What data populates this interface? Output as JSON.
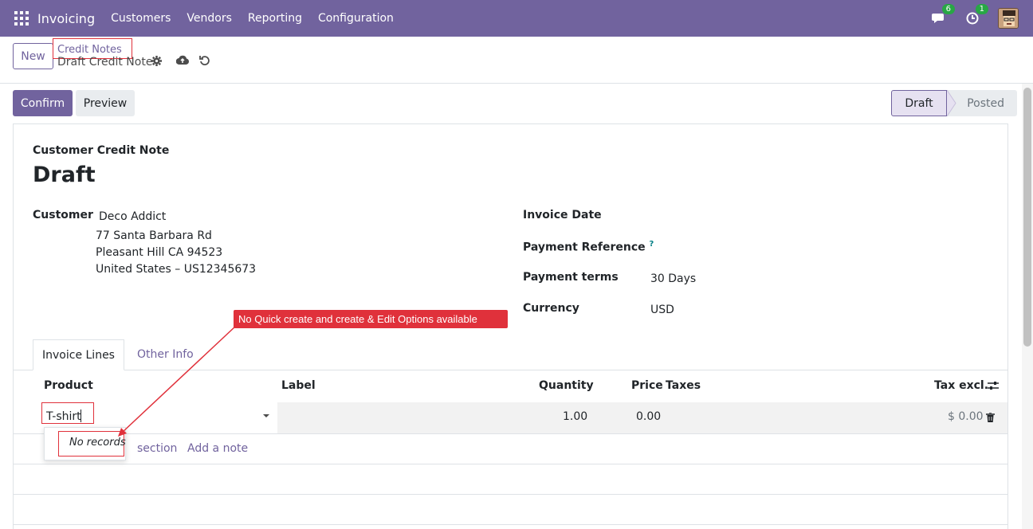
{
  "topbar": {
    "app_name": "Invoicing",
    "menu": [
      "Customers",
      "Vendors",
      "Reporting",
      "Configuration"
    ],
    "messages_badge": "6",
    "activities_badge": "1"
  },
  "control": {
    "new_label": "New",
    "breadcrumb": "Credit Notes",
    "record_name": "Draft Credit Note"
  },
  "actions": {
    "confirm_label": "Confirm",
    "preview_label": "Preview",
    "status": [
      "Draft",
      "Posted"
    ]
  },
  "form": {
    "doc_type": "Customer Credit Note",
    "title": "Draft",
    "customer_label": "Customer",
    "customer_name": "Deco Addict",
    "address_line1": "77 Santa Barbara Rd",
    "address_line2": "Pleasant Hill CA 94523",
    "address_line3": "United States – US12345673",
    "invoice_date_label": "Invoice Date",
    "payment_reference_label": "Payment Reference",
    "payment_reference_help": "?",
    "payment_terms_label": "Payment terms",
    "payment_terms_value": "30 Days",
    "currency_label": "Currency",
    "currency_value": "USD"
  },
  "tabs": [
    "Invoice Lines",
    "Other Info"
  ],
  "table": {
    "headers": {
      "product": "Product",
      "label": "Label",
      "quantity": "Quantity",
      "price": "Price",
      "taxes": "Taxes",
      "tax_excl": "Tax excl."
    },
    "row": {
      "product": "T-shirt",
      "quantity": "1.00",
      "price": "0.00",
      "tax_excl": "$ 0.00"
    },
    "dropdown_empty": "No records",
    "add_section": "section",
    "add_note": "Add a note"
  },
  "annotation": {
    "callout": "No Quick create and create & Edit Options available"
  },
  "colors": {
    "brand": "#71639e",
    "annotation": "#e0313b",
    "badge": "#28a745"
  }
}
